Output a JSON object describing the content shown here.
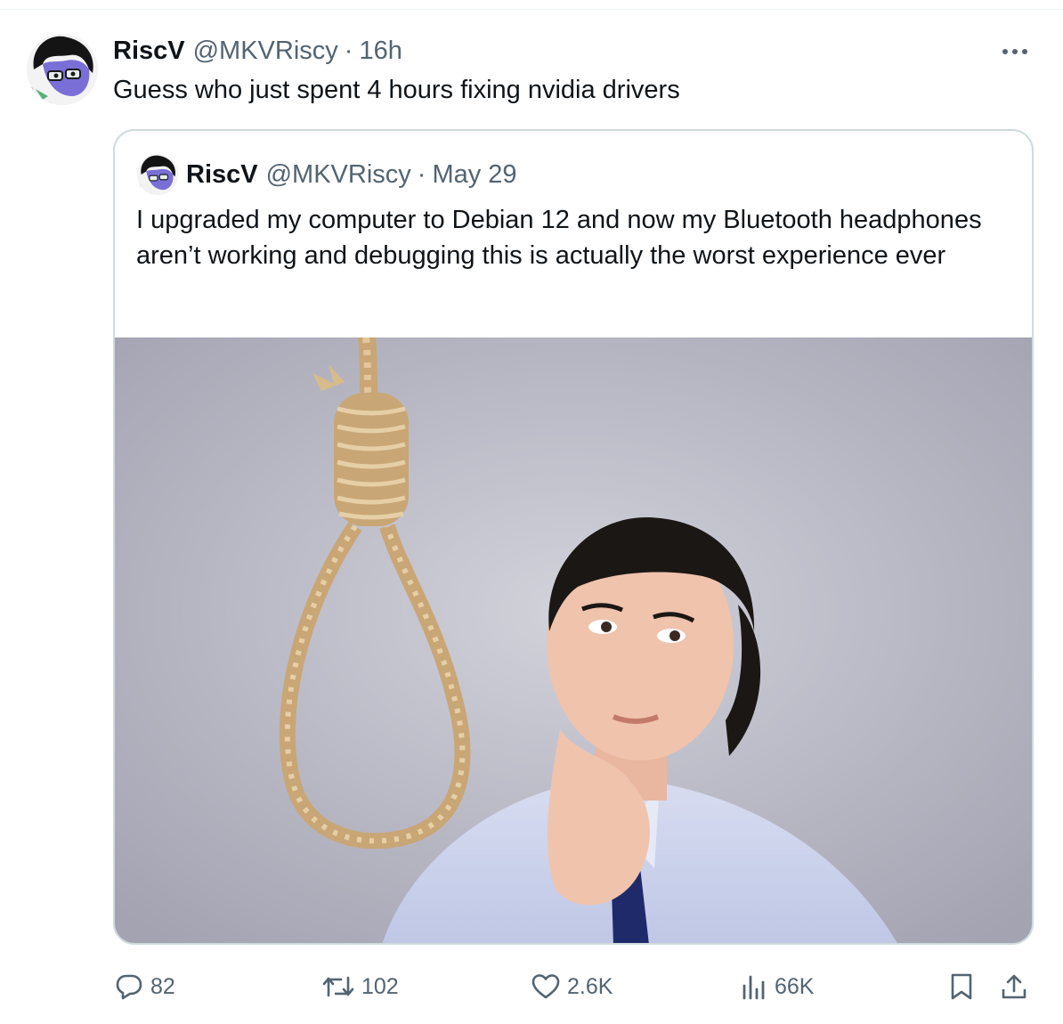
{
  "tweet": {
    "author_name": "RiscV",
    "author_handle": "@MKVRiscy",
    "separator": "·",
    "time": "16h",
    "text": "Guess who just spent 4 hours fixing nvidia drivers"
  },
  "quoted_tweet": {
    "author_name": "RiscV",
    "author_handle": "@MKVRiscy",
    "separator": "·",
    "time": "May 29",
    "text": "I upgraded my computer to Debian 12 and now my Bluetooth headphones aren’t working and debugging this is actually the worst experience ever"
  },
  "actions": {
    "replies": "82",
    "reposts": "102",
    "likes": "2.6K",
    "views": "66K"
  },
  "icons": {
    "more": "more-dots-icon",
    "reply": "reply-bubble-icon",
    "repost": "repost-icon",
    "like": "heart-icon",
    "views": "views-bar-chart-icon",
    "bookmark": "bookmark-icon",
    "share": "share-icon"
  },
  "colors": {
    "text_primary": "#0f1419",
    "text_secondary": "#536471",
    "border": "#cfd9de"
  }
}
